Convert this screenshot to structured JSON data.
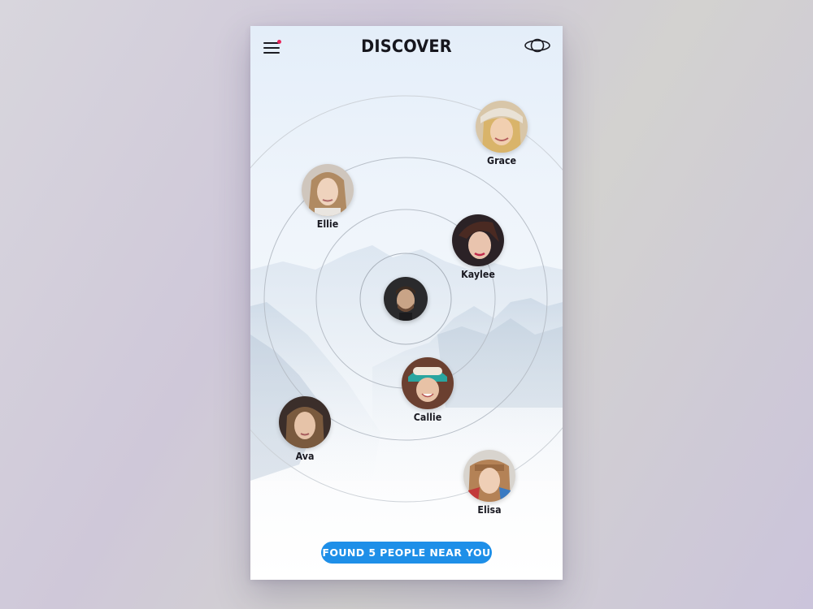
{
  "header": {
    "title": "DISCOVER",
    "menu_icon": "hamburger-menu-icon",
    "notification_color": "#e8245a",
    "right_icon": "orbit-icon"
  },
  "user": {
    "avatar": "current-user-avatar"
  },
  "people": [
    {
      "name": "Grace"
    },
    {
      "name": "Ellie"
    },
    {
      "name": "Kaylee"
    },
    {
      "name": "Callie"
    },
    {
      "name": "Ava"
    },
    {
      "name": "Elisa"
    }
  ],
  "footer": {
    "found_label": "FOUND 5 PEOPLE NEAR YOU",
    "button_color": "#1e8fe8"
  }
}
